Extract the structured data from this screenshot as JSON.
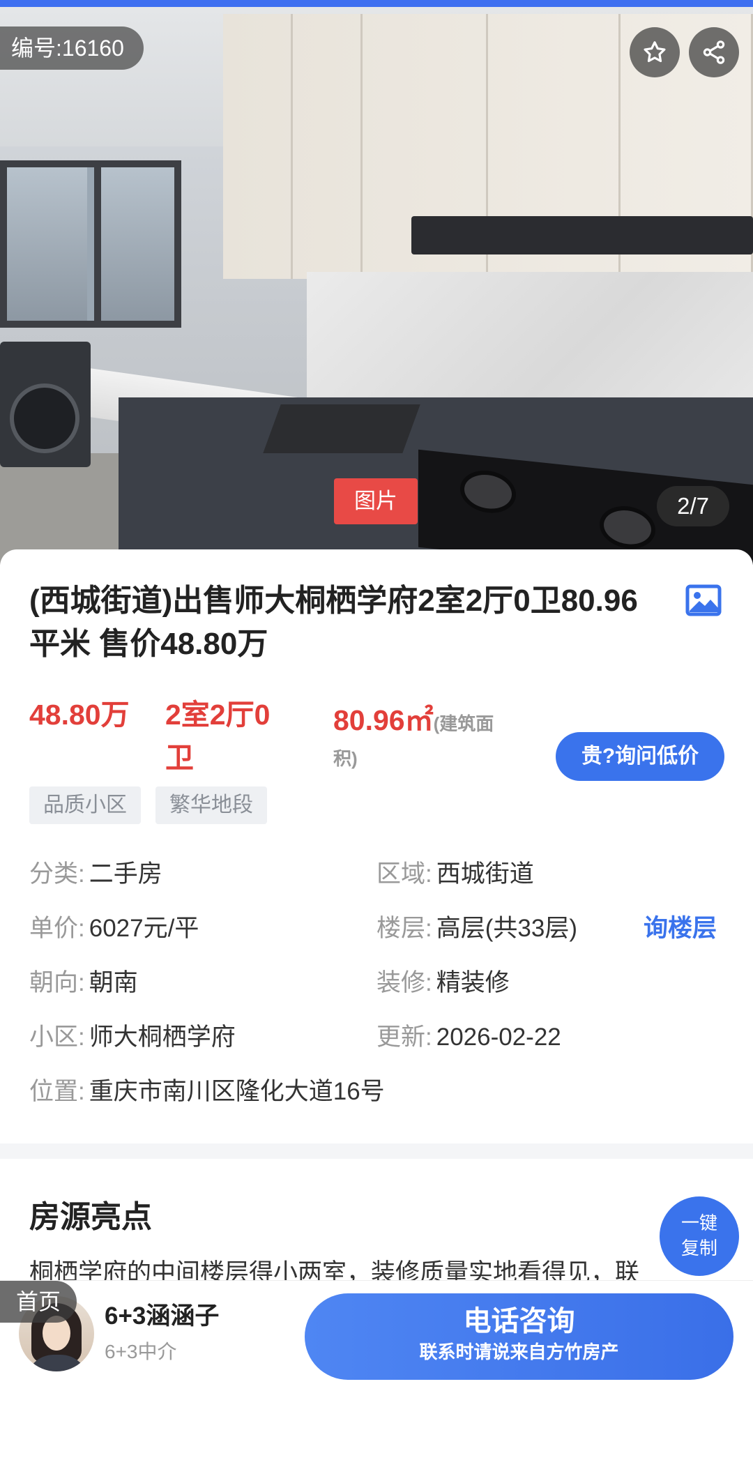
{
  "photo": {
    "listing_id": "编号:16160",
    "tag": "图片",
    "counter": "2/7"
  },
  "listing": {
    "title": "(西城街道)出售师大桐栖学府2室2厅0卫80.96平米 售价48.80万",
    "price": "48.80万",
    "layout": "2室2厅0卫",
    "area": "80.96㎡",
    "area_note_a": "(建筑面",
    "area_note_b": "积)",
    "ask_button": "贵?询问低价",
    "tags": [
      "品质小区",
      "繁华地段"
    ]
  },
  "info": {
    "category": {
      "label": "分类:",
      "value": "二手房"
    },
    "district": {
      "label": "区域:",
      "value": "西城街道"
    },
    "unit_price": {
      "label": "单价:",
      "value": "6027元/平"
    },
    "floor": {
      "label": "楼层:",
      "value": "高层(共33层)"
    },
    "floor_ask": "询楼层",
    "orientation": {
      "label": "朝向:",
      "value": "朝南"
    },
    "decoration": {
      "label": "装修:",
      "value": "精装修"
    },
    "community": {
      "label": "小区:",
      "value": "师大桐栖学府"
    },
    "updated": {
      "label": "更新:",
      "value": "2026-02-22"
    },
    "location": {
      "label": "位置:",
      "value": "重庆市南川区隆化大道16号"
    }
  },
  "highlights": {
    "title": "房源亮点",
    "text": "桐栖学府的中间楼层得小两室，装修质量实地看得见，联",
    "copy_line1": "一键",
    "copy_line2": "复制"
  },
  "bottom": {
    "home": "首页",
    "agent_name": "6+3涵涵子",
    "agent_org": "6+3中介",
    "call_main": "电话咨询",
    "call_sub": "联系时请说来自方竹房产"
  },
  "colors": {
    "accent": "#3a73ec",
    "price": "#e23f3a",
    "pic_tag": "#e84a46"
  }
}
